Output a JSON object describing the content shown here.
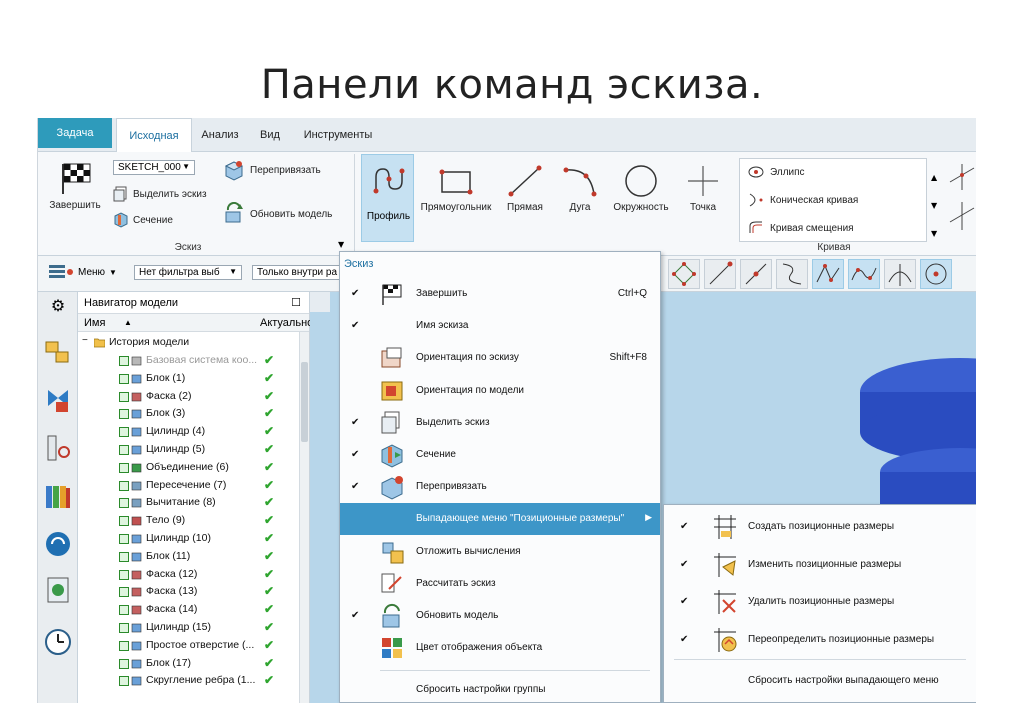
{
  "slide_title": "Панели команд эскиза.",
  "tabs": {
    "task": "Задача",
    "home": "Исходная",
    "analysis": "Анализ",
    "view": "Вид",
    "tools": "Инструменты"
  },
  "ribbon": {
    "finish": "Завершить",
    "sketch_name": "SKETCH_000",
    "select_sketch": "Выделить эскиз",
    "section": "Сечение",
    "reattach": "Перепривязать",
    "update_model": "Обновить модель",
    "sketch_group": "Эскиз",
    "profile": "Профиль",
    "rectangle": "Прямоугольник",
    "line": "Прямая",
    "arc": "Дуга",
    "circle": "Окружность",
    "point": "Точка",
    "ellipse": "Эллипс",
    "conic": "Коническая кривая",
    "offset_curve": "Кривая смещения",
    "curve_group": "Кривая"
  },
  "toolbar2": {
    "menu": "Меню",
    "filter": "Нет фильтра выб",
    "scope": "Только внутри ра"
  },
  "navigator": {
    "title": "Навигатор модели",
    "col_name": "Имя",
    "col_current": "Актуально",
    "root": "История модели",
    "items": [
      "Базовая система коо...",
      "Блок (1)",
      "Фаска (2)",
      "Блок (3)",
      "Цилиндр (4)",
      "Цилиндр (5)",
      "Объединение (6)",
      "Пересечение (7)",
      "Вычитание (8)",
      "Тело (9)",
      "Цилиндр (10)",
      "Блок (11)",
      "Фаска (12)",
      "Фаска (13)",
      "Фаска (14)",
      "Цилиндр (15)",
      "Простое отверстие (...",
      "Блок (17)",
      "Скругление ребра (1..."
    ]
  },
  "context_menu": {
    "title": "Эскиз",
    "items": [
      {
        "label": "Завершить",
        "shortcut": "Ctrl+Q",
        "checked": "✔"
      },
      {
        "label": "Имя эскиза",
        "shortcut": "",
        "checked": "✔"
      },
      {
        "label": "Ориентация по эскизу",
        "shortcut": "Shift+F8",
        "checked": ""
      },
      {
        "label": "Ориентация по модели",
        "shortcut": "",
        "checked": ""
      },
      {
        "label": "Выделить эскиз",
        "shortcut": "",
        "checked": "✔"
      },
      {
        "label": "Сечение",
        "shortcut": "",
        "checked": "✔"
      },
      {
        "label": "Перепривязать",
        "shortcut": "",
        "checked": "✔"
      },
      {
        "label": "Выпадающее меню \"Позиционные размеры\"",
        "shortcut": "",
        "checked": ""
      },
      {
        "label": "Отложить вычисления",
        "shortcut": "",
        "checked": ""
      },
      {
        "label": "Рассчитать эскиз",
        "shortcut": "",
        "checked": ""
      },
      {
        "label": "Обновить модель",
        "shortcut": "",
        "checked": "✔"
      },
      {
        "label": "Цвет отображения объекта",
        "shortcut": "",
        "checked": ""
      }
    ],
    "reset": "Сбросить настройки группы"
  },
  "submenu": {
    "items": [
      "Создать позиционные размеры",
      "Изменить позиционные размеры",
      "Удалить позиционные размеры",
      "Переопределить позиционные размеры"
    ],
    "reset": "Сбросить настройки выпадающего меню"
  }
}
